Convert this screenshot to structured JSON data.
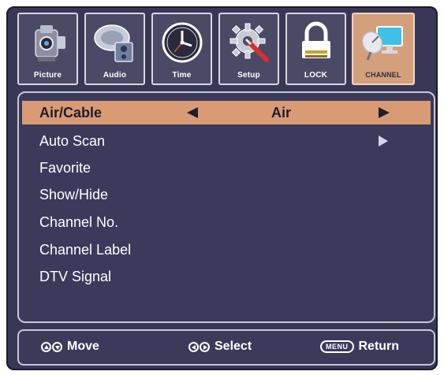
{
  "tabs": [
    {
      "label": "Picture",
      "icon": "camcorder-icon",
      "active": false
    },
    {
      "label": "Audio",
      "icon": "speaker-dish-icon",
      "active": false
    },
    {
      "label": "Time",
      "icon": "clock-icon",
      "active": false
    },
    {
      "label": "Setup",
      "icon": "gear-screwdriver-icon",
      "active": false
    },
    {
      "label": "LOCK",
      "icon": "padlock-icon",
      "active": false
    },
    {
      "label": "CHANNEL",
      "icon": "satellite-monitor-icon",
      "active": true
    }
  ],
  "menu": {
    "items": [
      {
        "label": "Air/Cable",
        "value": "Air",
        "selected": true
      },
      {
        "label": "Auto Scan"
      },
      {
        "label": "Favorite"
      },
      {
        "label": "Show/Hide"
      },
      {
        "label": "Channel No."
      },
      {
        "label": "Channel Label"
      },
      {
        "label": "DTV Signal"
      }
    ]
  },
  "footer": {
    "move_label": "Move",
    "select_label": "Select",
    "menu_key": "MENU",
    "return_label": "Return"
  },
  "colors": {
    "background": "#383756",
    "selected_row": "#d99b74",
    "active_tab": "#d4a07c"
  }
}
